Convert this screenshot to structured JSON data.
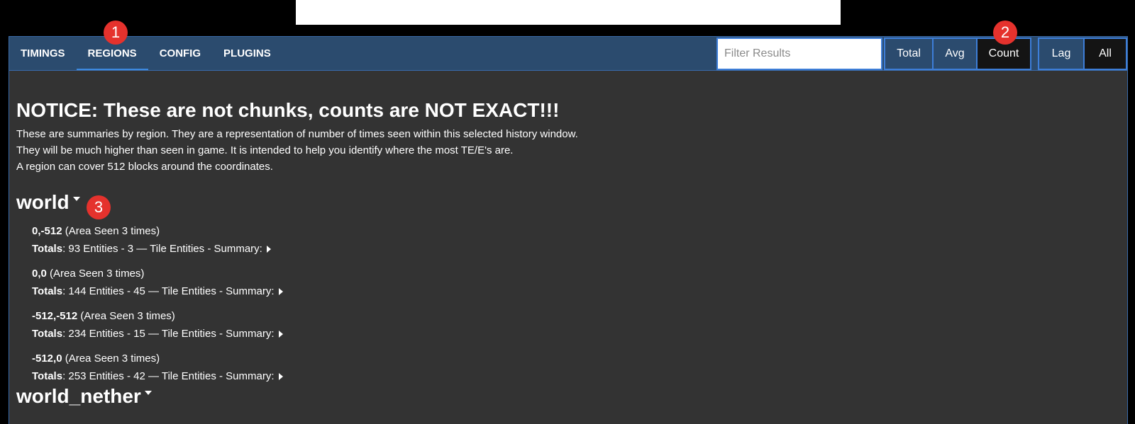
{
  "nav": {
    "tabs": [
      {
        "label": "TIMINGS"
      },
      {
        "label": "REGIONS"
      },
      {
        "label": "CONFIG"
      },
      {
        "label": "PLUGINS"
      }
    ],
    "filter_placeholder": "Filter Results",
    "sort_buttons": [
      "Total",
      "Avg",
      "Count"
    ],
    "selected_sort": "Count",
    "view_buttons": [
      "Lag",
      "All"
    ],
    "selected_view": "All"
  },
  "notice": {
    "title": "NOTICE: These are not chunks, counts are NOT EXACT!!!",
    "lines": [
      "These are summaries by region. They are a representation of number of times seen within this selected history window.",
      "They will be much higher than seen in game. It is intended to help you identify where the most TE/E's are.",
      "A region can cover 512 blocks around the coordinates."
    ]
  },
  "worlds": [
    {
      "name": "world",
      "regions": [
        {
          "coords": "0,-512",
          "seen": "(Area Seen 3 times)",
          "totals_label": "Totals",
          "summary": ": 93 Entities - 3 — Tile Entities - Summary:"
        },
        {
          "coords": "0,0",
          "seen": "(Area Seen 3 times)",
          "totals_label": "Totals",
          "summary": ": 144 Entities - 45 — Tile Entities - Summary:"
        },
        {
          "coords": "-512,-512",
          "seen": "(Area Seen 3 times)",
          "totals_label": "Totals",
          "summary": ": 234 Entities - 15 — Tile Entities - Summary:"
        },
        {
          "coords": "-512,0",
          "seen": "(Area Seen 3 times)",
          "totals_label": "Totals",
          "summary": ": 253 Entities - 42 — Tile Entities - Summary:"
        }
      ]
    },
    {
      "name": "world_nether",
      "regions": []
    }
  ],
  "badges": [
    "1",
    "2",
    "3"
  ],
  "colors": {
    "nav_bg": "#2b4b6e",
    "accent": "#3d7ed8",
    "content_bg": "#333333",
    "selected_bg": "#141414",
    "badge": "#e5322d"
  }
}
